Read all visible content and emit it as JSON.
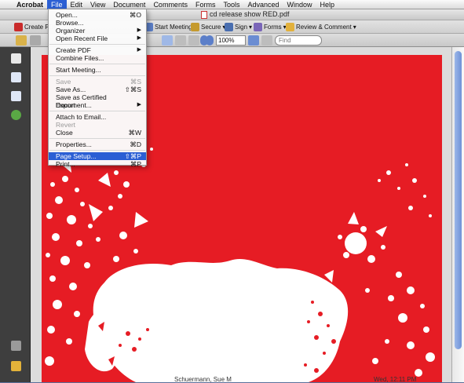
{
  "menubar": {
    "apple": "",
    "items": [
      {
        "label": "Acrobat"
      },
      {
        "label": "File"
      },
      {
        "label": "Edit"
      },
      {
        "label": "View"
      },
      {
        "label": "Document"
      },
      {
        "label": "Comments"
      },
      {
        "label": "Forms"
      },
      {
        "label": "Tools"
      },
      {
        "label": "Advanced"
      },
      {
        "label": "Window"
      },
      {
        "label": "Help"
      }
    ]
  },
  "window": {
    "title": "cd release show RED.pdf"
  },
  "toolbar": {
    "create_pdf": "Create PDF",
    "start_meeting": "Start Meeting",
    "secure": "Secure",
    "sign": "Sign",
    "forms": "Forms",
    "review_comment": "Review & Comment",
    "zoom": "100%",
    "find_placeholder": "Find"
  },
  "file_menu": {
    "items": [
      {
        "label": "Open...",
        "shortcut": "⌘O"
      },
      {
        "label": "Browse...",
        "shortcut": ""
      },
      {
        "label": "Organizer",
        "shortcut": "▶"
      },
      {
        "label": "Open Recent File",
        "shortcut": "▶"
      },
      {
        "label": "Create PDF",
        "shortcut": "▶"
      },
      {
        "label": "Combine Files...",
        "shortcut": ""
      },
      {
        "label": "Start Meeting...",
        "shortcut": ""
      },
      {
        "label": "Save",
        "shortcut": "⌘S"
      },
      {
        "label": "Save As...",
        "shortcut": "⇧⌘S"
      },
      {
        "label": "Save as Certified Document...",
        "shortcut": ""
      },
      {
        "label": "Export",
        "shortcut": "▶"
      },
      {
        "label": "Attach to Email...",
        "shortcut": ""
      },
      {
        "label": "Revert",
        "shortcut": ""
      },
      {
        "label": "Close",
        "shortcut": "⌘W"
      },
      {
        "label": "Properties...",
        "shortcut": "⌘D"
      },
      {
        "label": "Page Setup...",
        "shortcut": "⇧⌘P"
      },
      {
        "label": "Print...",
        "shortcut": "⌘P"
      }
    ]
  },
  "status": {
    "author": "Schuermann, Sue M",
    "time": "Wed, 12:11 PM"
  },
  "colors": {
    "page_red": "#e61c24",
    "highlight": "#2b5fd4"
  }
}
